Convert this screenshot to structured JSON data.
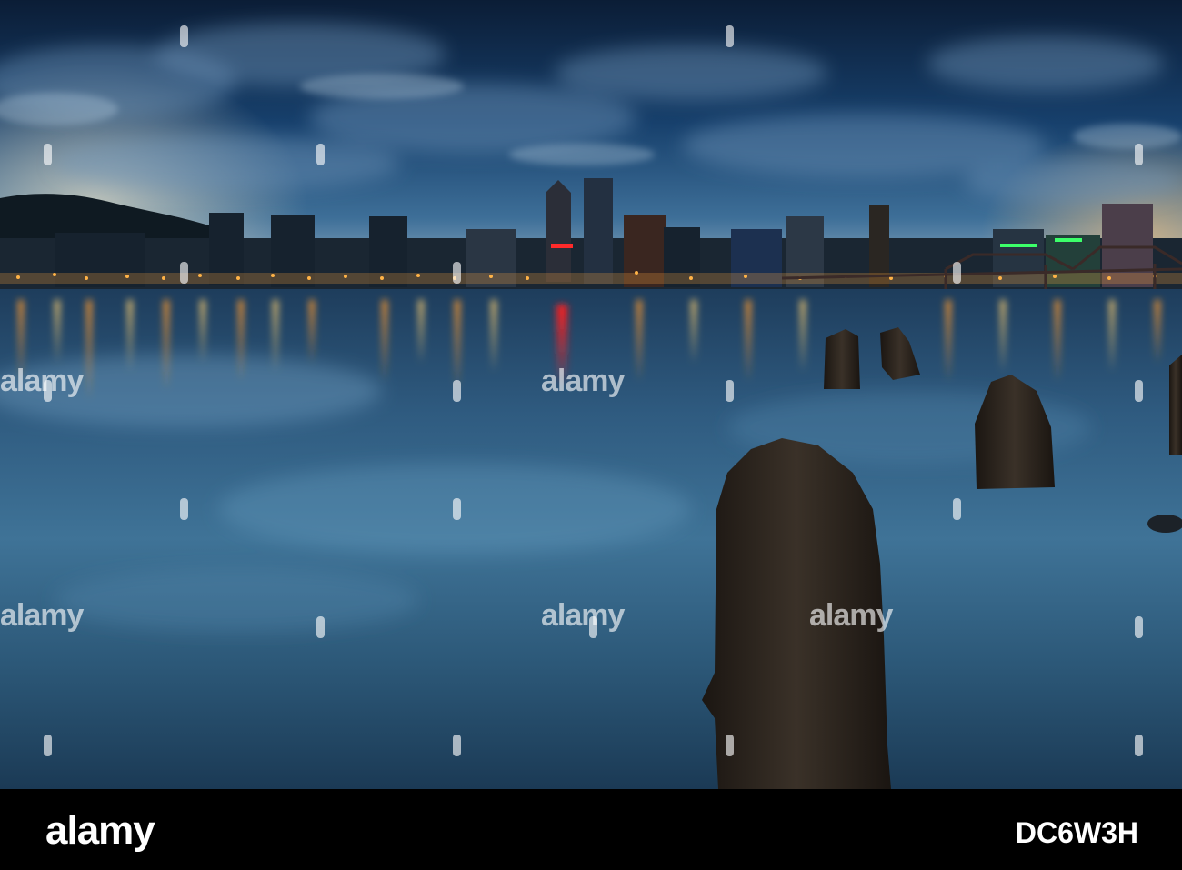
{
  "photo": {
    "sky_colors": [
      "#0e2440",
      "#1d4f80",
      "#7fa9c8"
    ],
    "water_colors": [
      "#1b3a58",
      "#3c6d90",
      "#234b6c"
    ],
    "light_colors": [
      "#ff9a2e",
      "#ffcf6a",
      "#ff2a2a",
      "#3cff6a"
    ]
  },
  "watermark": {
    "text": "alamy"
  },
  "footer": {
    "logo": "alamy",
    "image_id": "DC6W3H"
  }
}
